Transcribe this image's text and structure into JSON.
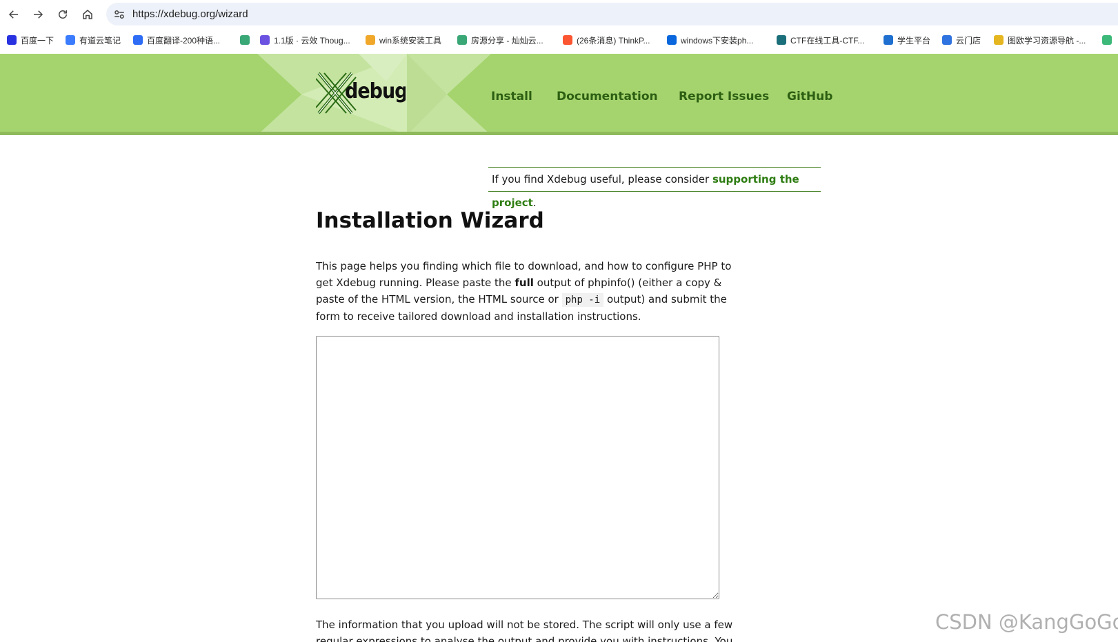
{
  "browser": {
    "url": "https://xdebug.org/wizard",
    "bookmarks": [
      {
        "label": "百度一下",
        "icon": "baidu-paw-icon",
        "color": "#2932e1"
      },
      {
        "label": "有道云笔记",
        "icon": "youdao-note-icon",
        "color": "#3b7cff"
      },
      {
        "label": "百度翻译-200种语...",
        "icon": "baidu-translate-icon",
        "color": "#2e6cf6"
      },
      {
        "label": "",
        "icon": "vue-icon",
        "color": "#3aa776"
      },
      {
        "label": "1.1版 · 云效 Thoug...",
        "icon": "yunxiao-icon",
        "color": "#6b52e0"
      },
      {
        "label": "win系统安装工具",
        "icon": "win-tool-icon",
        "color": "#f0a72a"
      },
      {
        "label": "房源分享 - 灿灿云...",
        "icon": "vue-icon",
        "color": "#3aa776"
      },
      {
        "label": "(26条消息) ThinkP...",
        "icon": "csdn-icon",
        "color": "#fc5531"
      },
      {
        "label": "windows下安装ph...",
        "icon": "zhihu-icon",
        "color": "#0a66dc"
      },
      {
        "label": "CTF在线工具-CTF...",
        "icon": "ctf-tool-icon",
        "color": "#1b6f7a"
      },
      {
        "label": "学生平台",
        "icon": "student-platform-icon",
        "color": "#1e6fd0"
      },
      {
        "label": "云门店",
        "icon": "store-icon",
        "color": "#2f73e0"
      },
      {
        "label": "图欧学习资源导航 -...",
        "icon": "tuou-icon",
        "color": "#e5b61f"
      },
      {
        "label": "",
        "icon": "overflow-bookmark-icon",
        "color": "#3cb878"
      }
    ]
  },
  "site": {
    "logo_text": "Xdebug",
    "nav": [
      "Install",
      "Documentation",
      "Report Issues",
      "GitHub"
    ]
  },
  "support": {
    "prefix": "If you find Xdebug useful, please consider ",
    "link": "supporting the project",
    "suffix": "."
  },
  "page": {
    "title": "Installation Wizard",
    "intro_1": "This page helps you finding which file to download, and how to configure PHP to get Xdebug running. Please paste the ",
    "intro_bold": "full",
    "intro_2": " output of phpinfo() (either a copy & paste of the HTML version, the HTML source or ",
    "intro_code": "php -i",
    "intro_3": " output) and submit the form to receive tailored download and installation instructions.",
    "textarea_value": "",
    "notice": "The information that you upload will not be stored. The script will only use a few regular expressions to analyse the output and provide you with instructions. You can"
  },
  "watermark": "CSDN @KangGoGo",
  "colors": {
    "header_green": "#a5d46e",
    "nav_text": "#2c5f12",
    "link_green": "#2e7d12"
  }
}
